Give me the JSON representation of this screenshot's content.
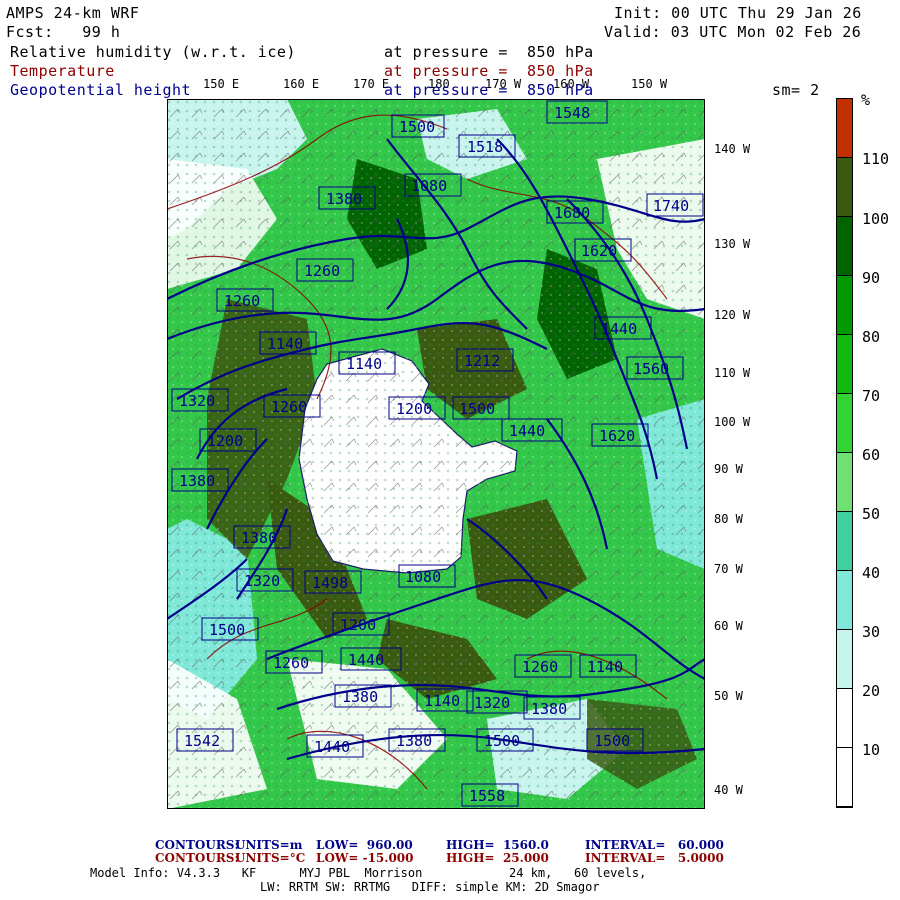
{
  "header": {
    "model": "AMPS 24-km WRF",
    "init": "Init: 00 UTC Thu 29 Jan 26",
    "fcst": "Fcst:   99 h",
    "valid": "Valid: 03 UTC Mon 02 Feb 26",
    "field1": "Relative humidity (w.r.t. ice)",
    "field2": "Temperature",
    "field3": "Geopotential height",
    "level1": "at pressure =  850 hPa",
    "level2": "at pressure =  850 hPa",
    "level3": "at pressure =  850 hPa",
    "sm": "sm= 2"
  },
  "lon_labels": [
    "150 E",
    "160 E",
    "170 E",
    "180",
    "170 W",
    "160 W",
    "150 W"
  ],
  "lat_labels": [
    "140 W",
    "130 W",
    "120 W",
    "110 W",
    "100 W",
    "90 W",
    "80 W",
    "70 W",
    "60 W",
    "50 W",
    "40 W"
  ],
  "colorbar": {
    "unit": "%",
    "labels": [
      "110",
      "100",
      "90",
      "80",
      "70",
      "60",
      "50",
      "40",
      "30",
      "20",
      "10"
    ],
    "colors": [
      "#c03000",
      "#3a5a10",
      "#006400",
      "#009a00",
      "#10b810",
      "#34d334",
      "#70e070",
      "#40d0a0",
      "#80e8d8",
      "#c8f4ee",
      "#ffffff",
      "#ffffff"
    ]
  },
  "height_labels": [
    "1500",
    "1518",
    "1548",
    "1740",
    "1380",
    "1080",
    "1680",
    "1620",
    "1260",
    "1440",
    "1560",
    "1212",
    "1200",
    "1140",
    "1500",
    "1320",
    "1380",
    "1260",
    "1140",
    "1260",
    "1080",
    "1380",
    "1620",
    "1320",
    "1200",
    "1260",
    "1380",
    "1140",
    "1260",
    "1500",
    "1440",
    "1380",
    "1200",
    "1140",
    "1320",
    "1380",
    "1500",
    "1440",
    "1500",
    "1498",
    "1542",
    "1440",
    "1558"
  ],
  "footer": {
    "c1_label": "CONTOURS:",
    "c1_units": "UNITS=m",
    "c1_low": "LOW=  960.00",
    "c1_high": "HIGH=  1560.0",
    "c1_interval": "INTERVAL=   60.000",
    "c2_label": "CONTOURS:",
    "c2_units": "UNITS=°C",
    "c2_low": "LOW= -15.000",
    "c2_high": "HIGH=  25.000",
    "c2_interval": "INTERVAL=   5.0000",
    "model_line1": "Model Info: V4.3.3   KF      MYJ PBL  Morrison            24 km,   60 levels,",
    "model_line2": "LW: RRTM SW: RRTMG   DIFF: simple KM: 2D Smagor"
  },
  "colors": {
    "height_contour": "#00008b",
    "temp_contour": "#8b0000"
  }
}
